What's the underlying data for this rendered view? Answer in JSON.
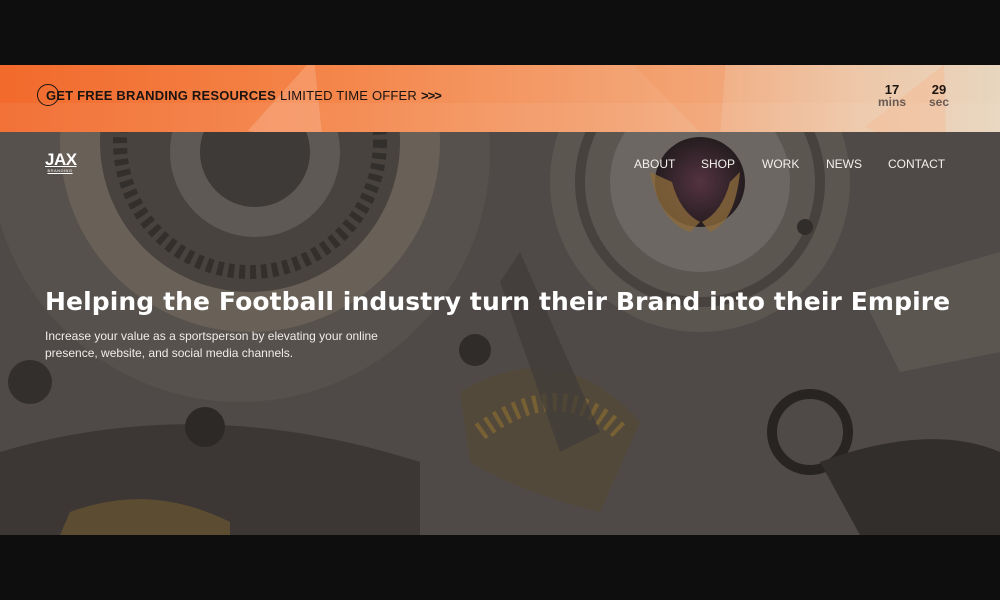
{
  "promo": {
    "headline": "GET FREE BRANDING RESOURCES",
    "offer": "LIMITED TIME OFFER",
    "arrows": ">>>",
    "timer": {
      "mins_value": "17",
      "mins_label": "mins",
      "sec_value": "29",
      "sec_label": "sec"
    }
  },
  "brand": {
    "logo_text": "JAX",
    "logo_sub": "BRANDING"
  },
  "nav": {
    "items": [
      "ABOUT",
      "SHOP",
      "WORK",
      "NEWS",
      "CONTACT"
    ]
  },
  "hero": {
    "headline": "Helping the Football industry turn their Brand into their Empire",
    "subtext": "Increase your value as a sportsperson by elevating your online presence, website, and social media channels."
  },
  "colors": {
    "promo_start": "#f26a2c",
    "promo_end": "#e8d6bf",
    "text_light": "#ffffff",
    "page_bg": "#0e0e0e"
  }
}
